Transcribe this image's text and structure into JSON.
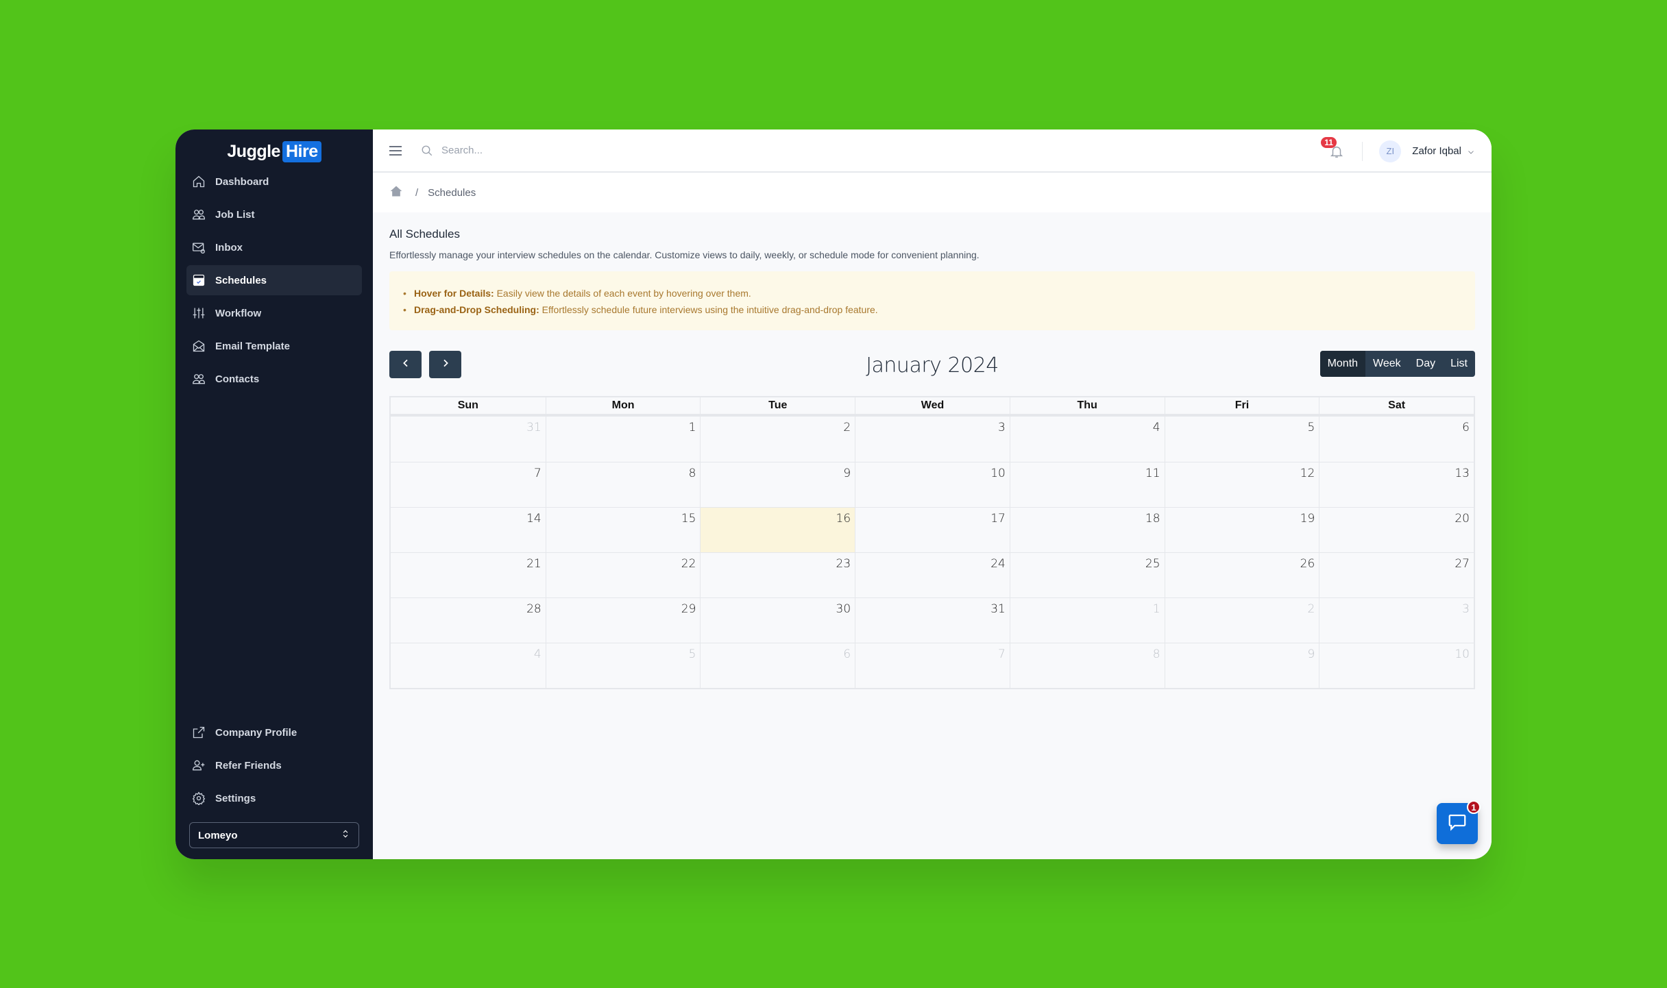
{
  "app": {
    "logo_part1": "Juggle",
    "logo_part2": "Hire",
    "brand_color": "#1470e0",
    "background_color": "#52c41a"
  },
  "sidebar": {
    "items": [
      {
        "label": "Dashboard",
        "icon": "home-icon",
        "active": false
      },
      {
        "label": "Job List",
        "icon": "users-icon",
        "active": false
      },
      {
        "label": "Inbox",
        "icon": "mail-at-icon",
        "active": false
      },
      {
        "label": "Schedules",
        "icon": "calendar-check-icon",
        "active": true
      },
      {
        "label": "Workflow",
        "icon": "sliders-icon",
        "active": false
      },
      {
        "label": "Email Template",
        "icon": "mail-open-icon",
        "active": false
      },
      {
        "label": "Contacts",
        "icon": "users-icon",
        "active": false
      }
    ],
    "bottom_items": [
      {
        "label": "Company Profile",
        "icon": "external-link-icon"
      },
      {
        "label": "Refer Friends",
        "icon": "user-plus-icon"
      },
      {
        "label": "Settings",
        "icon": "gear-icon"
      }
    ],
    "org_select": {
      "value": "Lomeyo"
    }
  },
  "topbar": {
    "search_placeholder": "Search...",
    "notification_count": "11",
    "user_initials": "ZI",
    "user_name": "Zafor Iqbal"
  },
  "breadcrumb": {
    "separator": "/",
    "current": "Schedules"
  },
  "page": {
    "title": "All Schedules",
    "description": "Effortlessly manage your interview schedules on the calendar. Customize views to daily, weekly, or schedule mode for convenient planning.",
    "tips": [
      {
        "bold": "Hover for Details:",
        "text": " Easily view the details of each event by hovering over them."
      },
      {
        "bold": "Drag-and-Drop Scheduling:",
        "text": " Effortlessly schedule future interviews using the intuitive drag-and-drop feature."
      }
    ]
  },
  "calendar": {
    "title": "January 2024",
    "views": [
      {
        "label": "Month",
        "active": true
      },
      {
        "label": "Week",
        "active": false
      },
      {
        "label": "Day",
        "active": false
      },
      {
        "label": "List",
        "active": false
      }
    ],
    "weekdays": [
      "Sun",
      "Mon",
      "Tue",
      "Wed",
      "Thu",
      "Fri",
      "Sat"
    ],
    "today": 16,
    "weeks": [
      [
        {
          "d": "31",
          "other": true
        },
        {
          "d": "1"
        },
        {
          "d": "2"
        },
        {
          "d": "3"
        },
        {
          "d": "4"
        },
        {
          "d": "5"
        },
        {
          "d": "6"
        }
      ],
      [
        {
          "d": "7"
        },
        {
          "d": "8"
        },
        {
          "d": "9"
        },
        {
          "d": "10"
        },
        {
          "d": "11"
        },
        {
          "d": "12"
        },
        {
          "d": "13"
        }
      ],
      [
        {
          "d": "14"
        },
        {
          "d": "15"
        },
        {
          "d": "16",
          "today": true
        },
        {
          "d": "17"
        },
        {
          "d": "18"
        },
        {
          "d": "19"
        },
        {
          "d": "20"
        }
      ],
      [
        {
          "d": "21"
        },
        {
          "d": "22"
        },
        {
          "d": "23"
        },
        {
          "d": "24"
        },
        {
          "d": "25"
        },
        {
          "d": "26"
        },
        {
          "d": "27"
        }
      ],
      [
        {
          "d": "28"
        },
        {
          "d": "29"
        },
        {
          "d": "30"
        },
        {
          "d": "31"
        },
        {
          "d": "1",
          "other": true
        },
        {
          "d": "2",
          "other": true
        },
        {
          "d": "3",
          "other": true
        }
      ],
      [
        {
          "d": "4",
          "other": true
        },
        {
          "d": "5",
          "other": true
        },
        {
          "d": "6",
          "other": true
        },
        {
          "d": "7",
          "other": true
        },
        {
          "d": "8",
          "other": true
        },
        {
          "d": "9",
          "other": true
        },
        {
          "d": "10",
          "other": true
        }
      ]
    ]
  },
  "chat": {
    "badge_count": "1"
  }
}
